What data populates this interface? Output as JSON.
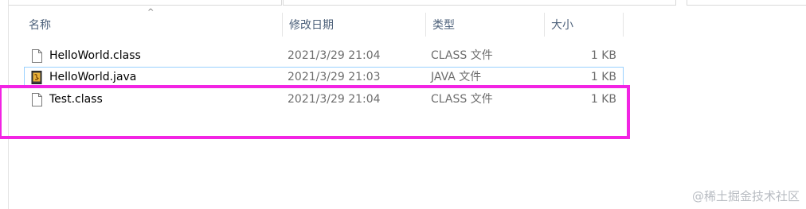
{
  "columns": {
    "name": "名称",
    "date": "修改日期",
    "type": "类型",
    "size": "大小"
  },
  "files": [
    {
      "name": "HelloWorld.class",
      "date": "2021/3/29 21:04",
      "type": "CLASS 文件",
      "size": "1 KB",
      "icon": "class-file-icon"
    },
    {
      "name": "HelloWorld.java",
      "date": "2021/3/29 21:03",
      "type": "JAVA 文件",
      "size": "1 KB",
      "icon": "java-file-icon"
    },
    {
      "name": "Test.class",
      "date": "2021/3/29 21:04",
      "type": "CLASS 文件",
      "size": "1 KB",
      "icon": "class-file-icon"
    }
  ],
  "watermark": "@稀土掘金技术社区",
  "colors": {
    "highlight": "#f224e3",
    "selection": "#99d1ff",
    "header_text": "#4c607a"
  }
}
